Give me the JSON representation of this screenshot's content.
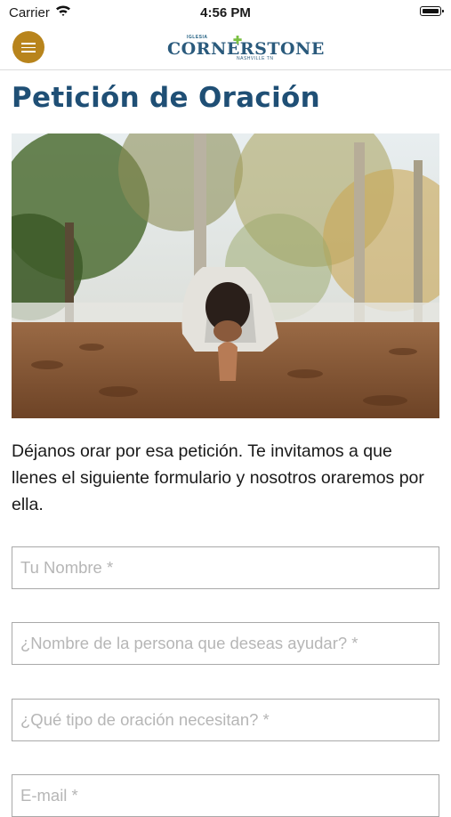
{
  "status_bar": {
    "carrier": "Carrier",
    "time": "4:56 PM"
  },
  "header": {
    "logo": {
      "small": "IGLESIA",
      "main": "CORNERSTONE",
      "sub": "NASHVILLE TN"
    }
  },
  "page": {
    "title": "Petición de Oración",
    "intro": "Déjanos orar por esa petición. Te invitamos a que llenes el siguiente formulario y nosotros oraremos por ella."
  },
  "form": {
    "name_placeholder": "Tu Nombre *",
    "person_placeholder": "¿Nombre de la persona que deseas ayudar? *",
    "prayer_type_placeholder": "¿Qué tipo de oración necesitan? *",
    "email_placeholder": "E-mail *"
  },
  "colors": {
    "accent": "#b8841c",
    "title": "#1f4f75"
  }
}
